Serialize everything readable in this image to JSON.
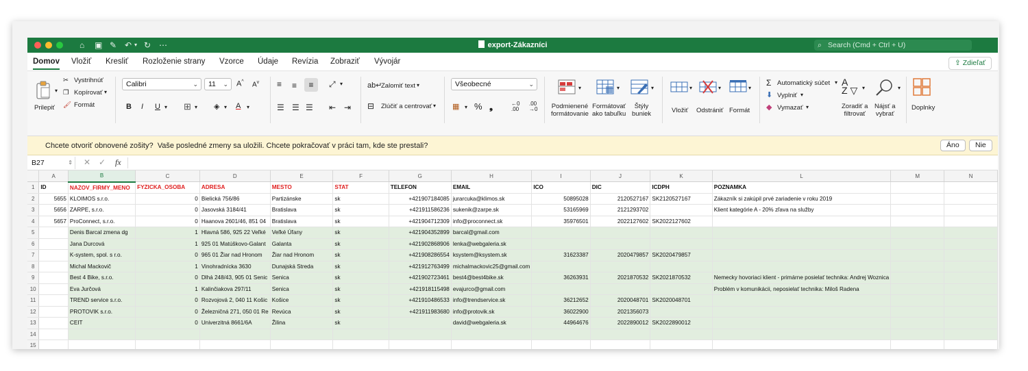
{
  "window": {
    "title": "export-Zákazníci",
    "search_placeholder": "Search (Cmd + Ctrl + U)",
    "traffic_colors": [
      "#ff5f57",
      "#febc2e",
      "#28c840"
    ]
  },
  "tabs": [
    "Domov",
    "Vložiť",
    "Kresliť",
    "Rozloženie strany",
    "Vzorce",
    "Údaje",
    "Revízia",
    "Zobraziť",
    "Vývojár"
  ],
  "share_label": "Zdieľať",
  "ribbon": {
    "paste": "Prilepiť",
    "cut": "Vystrihnúť",
    "copy": "Kopírovať",
    "format_painter": "Formát",
    "font_name": "Calibri",
    "font_size": "11",
    "wrap_text": "Zalomiť text",
    "merge_center": "Zlúčiť a centrovať",
    "number_format": "Všeobecné",
    "cond_format": [
      "Podmienené",
      "formátovanie"
    ],
    "format_table": [
      "Formátovať",
      "ako tabuľku"
    ],
    "cell_styles": [
      "Štýly",
      "buniek"
    ],
    "insert": "Vložiť",
    "delete": "Odstrániť",
    "format": "Formát",
    "autosum": "Automatický súčet",
    "fill": "Vyplniť",
    "clear": "Vymazať",
    "sort_filter": [
      "Zoradiť a",
      "filtrovať"
    ],
    "find_select": [
      "Nájsť a",
      "vybrať"
    ],
    "addins": "Doplnky"
  },
  "message_bar": {
    "question": "Chcete otvoriť obnovené zošity?",
    "text": "Vaše posledné zmeny sa uložili. Chcete pokračovať v práci tam, kde ste prestali?",
    "yes": "Áno",
    "no": "Nie"
  },
  "formula_bar": {
    "cell_ref": "B27",
    "fx": "fx",
    "content": ""
  },
  "sheet": {
    "columns": [
      "A",
      "B",
      "C",
      "D",
      "E",
      "F",
      "G",
      "H",
      "I",
      "J",
      "K",
      "L",
      "M",
      "N"
    ],
    "selected_column": "B",
    "header_row": [
      "ID",
      "NAZOV_FIRMY_MENO",
      "FYZICKA_OSOBA",
      "ADRESA",
      "MESTO",
      "STAT",
      "TELEFON",
      "EMAIL",
      "ICO",
      "DIC",
      "ICDPH",
      "POZNAMKA",
      "",
      ""
    ],
    "red_header_columns": [
      1,
      2,
      3,
      4,
      5
    ],
    "rows": [
      [
        "5655",
        "KLOIMOS s.r.o.",
        "0",
        "Bielická 756/86",
        "Partizánske",
        "sk",
        "+421907184085",
        "jurarcuka@klimos.sk",
        "50895028",
        "2120527167",
        "SK2120527167",
        "Zákazník si zakúpil prvé zariadenie v roku 2019",
        "",
        ""
      ],
      [
        "5656",
        "ZARPE, s.r.o.",
        "0",
        "Jasovská 3184/41",
        "Bratislava",
        "sk",
        "+421911586236",
        "sukenik@zarpe.sk",
        "53165969",
        "2121293702",
        "",
        "Klient kategórie A - 20% zľava na služby",
        "",
        ""
      ],
      [
        "5657",
        "ProConnect, s.r.o.",
        "0",
        "Haanova 2601/46, 851 04",
        "Bratislava",
        "sk",
        "+421904712309",
        "info@proconnect.sk",
        "35976501",
        "2022127602",
        "SK2022127602",
        "",
        "",
        ""
      ],
      [
        "",
        "Denis Barcal zmena dg",
        "1",
        "Hlavná 586, 925 22 Veľké",
        "Veľké Úľany",
        "sk",
        "+421904352899",
        "barcal@gmail.com",
        "",
        "",
        "",
        "",
        "",
        ""
      ],
      [
        "",
        "Jana Durcová",
        "1",
        "925 01 Matúškovo-Galant",
        "Galanta",
        "sk",
        "+421902868906",
        "lenka@webgaleria.sk",
        "",
        "",
        "",
        "",
        "",
        ""
      ],
      [
        "",
        "K-system, spol. s r.o.",
        "0",
        "965 01 Žiar nad Hronom",
        "Žiar nad Hronom",
        "sk",
        "+421908286554",
        "ksystem@ksystem.sk",
        "31623387",
        "2020479857",
        "SK2020479857",
        "",
        "",
        ""
      ],
      [
        "",
        "Michal Mackovič",
        "1",
        "Vinohradnícka 3630",
        "Dunajská Streda",
        "sk",
        "+421912763499",
        "michalmackovic25@gmail.com",
        "",
        "",
        "",
        "",
        "",
        ""
      ],
      [
        "",
        "Best 4 Bike, s.r.o.",
        "0",
        "Dlhá 248/43, 905 01 Senic",
        "Senica",
        "sk",
        "+421902723461",
        "best4@best4bike.sk",
        "36263931",
        "2021870532",
        "SK2021870532",
        "Nemecky hovoriaci klient - primárne posielať technika: Andrej Woznica",
        "",
        ""
      ],
      [
        "",
        "Eva Jurčová",
        "1",
        "Kalinčiakova 297/11",
        "Senica",
        "sk",
        "+421918115498",
        "evajurco@gmail.com",
        "",
        "",
        "",
        "Problém v komunikácii, neposielať technika: Miloš Radena",
        "",
        ""
      ],
      [
        "",
        "TREND service s.r.o.",
        "0",
        "Rozvojová 2, 040 11 Košic",
        "Košice",
        "sk",
        "+421910486533",
        "info@trendservice.sk",
        "36212652",
        "2020048701",
        "SK2020048701",
        "",
        "",
        ""
      ],
      [
        "",
        "PROTOVIK s.r.o.",
        "0",
        "Železničná 271, 050 01 Re",
        "Revúca",
        "sk",
        "+421911983680",
        "info@protovik.sk",
        "36022900",
        "2021356073",
        "",
        "",
        "",
        ""
      ],
      [
        "",
        "CEIT",
        "0",
        "Univerzitná 8661/6A",
        "Žilina",
        "sk",
        "",
        "david@webgaleria.sk",
        "44964676",
        "2022890012",
        "SK2022890012",
        "",
        "",
        ""
      ],
      [
        "",
        "",
        "",
        "",
        "",
        "",
        "",
        "",
        "",
        "",
        "",
        "",
        "",
        ""
      ],
      [
        "",
        "",
        "",
        "",
        "",
        "",
        "",
        "",
        "",
        "",
        "",
        "",
        "",
        ""
      ]
    ]
  }
}
